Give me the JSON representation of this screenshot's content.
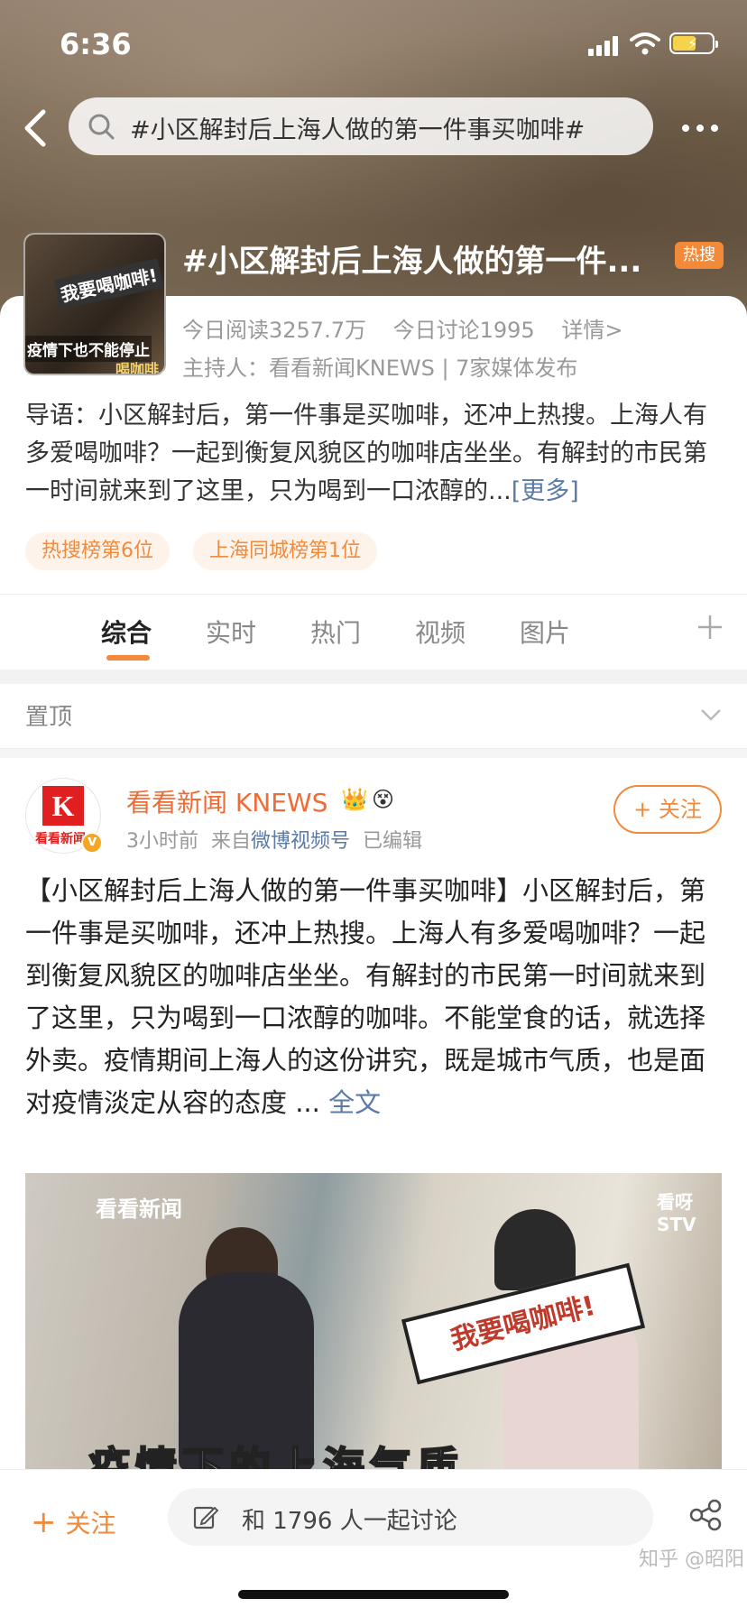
{
  "status_bar": {
    "time": "6:36"
  },
  "search": {
    "query": "#小区解封后上海人做的第一件事买咖啡#"
  },
  "topic": {
    "title": "#小区解封后上海人做的第一件...",
    "hot_badge": "热搜",
    "thumb_text_1": "我要喝咖啡!",
    "thumb_text_2": "疫情下也不能停止",
    "thumb_text_3": "喝咖啡",
    "read_count": "今日阅读3257.7万",
    "discuss_count": "今日讨论1995",
    "detail_link": "详情>",
    "host": "主持人：看看新闻KNEWS | 7家媒体发布",
    "intro": "导语：小区解封后，第一件事是买咖啡，还冲上热搜。上海人有多爱喝咖啡？一起到衡复风貌区的咖啡店坐坐。有解封的市民第一时间就来到了这里，只为喝到一口浓醇的...",
    "intro_more": "[更多]",
    "tags": [
      "热搜榜第6位",
      "上海同城榜第1位"
    ]
  },
  "tabs": [
    "综合",
    "实时",
    "热门",
    "视频",
    "图片"
  ],
  "pinned": {
    "label": "置顶"
  },
  "post": {
    "avatar_letter": "K",
    "avatar_text": "看看新闻",
    "author": "看看新闻 KNEWS",
    "time": "3小时前",
    "source_prefix": "来自",
    "source": "微博视频号",
    "edited": "已编辑",
    "follow_label": "+ 关注",
    "text": "【小区解封后上海人做的第一件事买咖啡】小区解封后，第一件事是买咖啡，还冲上热搜。上海人有多爱喝咖啡？一起到衡复风貌区的咖啡店坐坐。有解封的市民第一时间就来到了这里，只为喝到一口浓醇的咖啡。不能堂食的话，就选择外卖。疫情期间上海人的这份讲究，既是城市气质，也是面对疫情淡定从容的态度 ...",
    "full_text_link": "全文",
    "video": {
      "logo": "看看新闻",
      "stv": "看呀 STV",
      "bubble": "我要喝咖啡!",
      "caption": "疫情下的上海气质"
    }
  },
  "bottom_bar": {
    "follow_label": "关注",
    "discuss_label": "和 1796 人一起讨论"
  },
  "watermark": "知乎 @昭阳",
  "colors": {
    "accent": "#f28a3a",
    "link": "#5b7aa8",
    "author": "#f06c36"
  }
}
